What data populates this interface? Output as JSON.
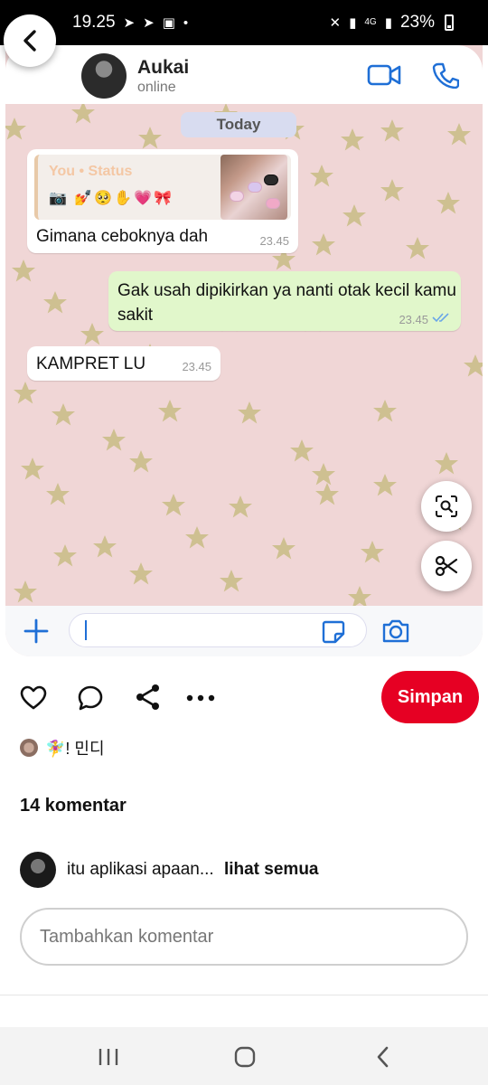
{
  "status_bar": {
    "time": "19.25",
    "battery": "23%",
    "network": "4G"
  },
  "chat": {
    "contact_name": "Aukai",
    "contact_status": "online",
    "date_label": "Today",
    "messages": [
      {
        "direction": "in",
        "quote_title": "You • Status",
        "quote_emojis": "📷 💅🥺✋💗🎀",
        "text": "Gimana ceboknya dah",
        "time": "23.45"
      },
      {
        "direction": "out",
        "text": "Gak usah dipikirkan ya nanti otak kecil kamu sakit",
        "time": "23.45"
      },
      {
        "direction": "in",
        "text": "KAMPRET LU",
        "time": "23.45"
      }
    ],
    "input_value": ""
  },
  "pin": {
    "save_label": "Simpan",
    "owner_name": "🧚‍♀️! 민디",
    "comment_count": "14 komentar",
    "top_comment": "itu aplikasi apaan...",
    "see_all_label": "lihat semua",
    "add_comment_placeholder": "Tambahkan komentar"
  },
  "colors": {
    "save_button": "#e60023",
    "chat_background": "#f0d6d6",
    "outgoing_bubble": "#e1f7cb",
    "incoming_bubble": "#ffffff",
    "accent_blue": "#1f6fd6"
  },
  "icons": [
    "back-arrow-icon",
    "video-call-icon",
    "phone-icon",
    "plus-icon",
    "sticker-icon",
    "camera-icon",
    "lens-icon",
    "scissors-icon",
    "heart-icon",
    "comment-icon",
    "share-icon",
    "more-icon",
    "recents-icon",
    "home-icon",
    "nav-back-icon"
  ]
}
